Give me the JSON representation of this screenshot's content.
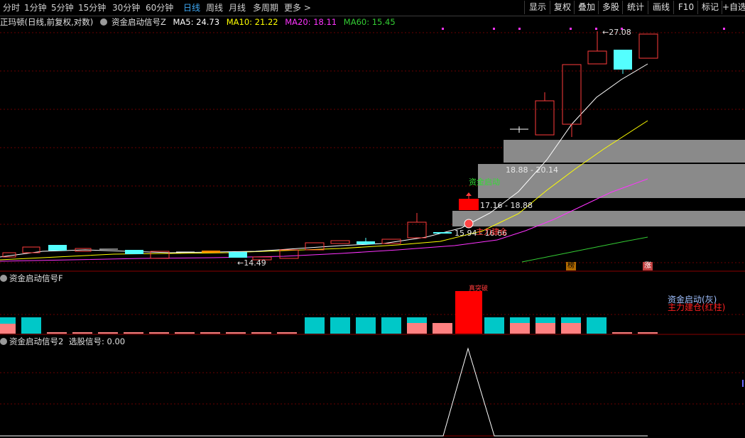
{
  "toolbar": {
    "periods": [
      "分时",
      "1分钟",
      "5分钟",
      "15分钟",
      "30分钟",
      "60分钟",
      "日线",
      "周线",
      "月线",
      "多周期",
      "更多 >"
    ],
    "active_period": "日线",
    "tools": [
      "显示",
      "复权",
      "叠加",
      "多股",
      "统计",
      "画线",
      "F10",
      "标记",
      "+自选"
    ]
  },
  "main_info": {
    "stock": "正玛顿(日线,前复权,对数)",
    "indicator": "资金启动信号Z",
    "ma5": "MA5: 24.73",
    "ma10": "MA10: 21.22",
    "ma20": "MA20: 18.11",
    "ma60": "MA60: 15.45"
  },
  "annotations": {
    "high_price": "27.08",
    "low_price": "14.49",
    "box1": "18.88 - 20.14",
    "box2": "17.16 - 18.88",
    "box3": "15.94 - 16.66",
    "start_label": "资金启动",
    "circle_label": "主力建仓",
    "tag_bang": "榜",
    "tag_zhang": "涨"
  },
  "sub1": {
    "title": "资金启动信号F",
    "legend1": "资金启动(灰)",
    "legend2": "主力建仓(红柱)",
    "bar_label": "真突破"
  },
  "sub2": {
    "title": "资金启动信号2",
    "value": "选股信号: 0.00"
  },
  "colors": {
    "up": "#ff3b3b",
    "down": "#54ffff",
    "ma5": "#ffffff",
    "ma10": "#ffff00",
    "ma20": "#ff33ff",
    "ma60": "#33cc33",
    "box": "#8a8a8a"
  }
}
